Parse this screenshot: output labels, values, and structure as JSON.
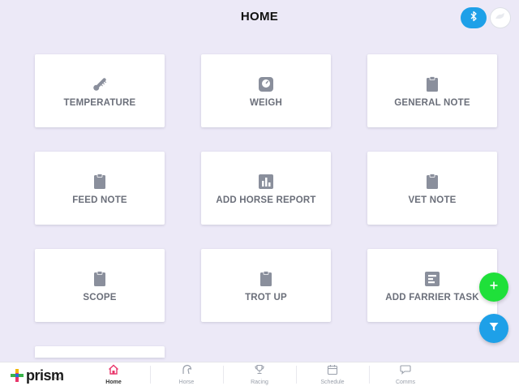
{
  "header": {
    "title": "HOME",
    "bluetooth_icon": "bluetooth-icon",
    "avatar_icon": "user-avatar"
  },
  "tiles": [
    {
      "label": "TEMPERATURE",
      "icon": "thermometer-icon"
    },
    {
      "label": "WEIGH",
      "icon": "scale-icon"
    },
    {
      "label": "GENERAL NOTE",
      "icon": "clipboard-icon"
    },
    {
      "label": "FEED NOTE",
      "icon": "clipboard-icon"
    },
    {
      "label": "ADD HORSE REPORT",
      "icon": "bar-chart-icon"
    },
    {
      "label": "VET NOTE",
      "icon": "clipboard-icon"
    },
    {
      "label": "SCOPE",
      "icon": "clipboard-icon"
    },
    {
      "label": "TROT UP",
      "icon": "clipboard-icon"
    },
    {
      "label": "ADD FARRIER TASK",
      "icon": "task-list-icon"
    }
  ],
  "fabs": {
    "add_icon": "plus-icon",
    "filter_icon": "filter-icon"
  },
  "logo": {
    "text": "prism",
    "sub": "PLUS"
  },
  "nav": [
    {
      "label": "Home",
      "icon": "home-icon",
      "active": true
    },
    {
      "label": "Horse",
      "icon": "horse-icon",
      "active": false
    },
    {
      "label": "Racing",
      "icon": "trophy-icon",
      "active": false
    },
    {
      "label": "Schedule",
      "icon": "calendar-icon",
      "active": false
    },
    {
      "label": "Comms",
      "icon": "chat-icon",
      "active": false
    }
  ],
  "colors": {
    "background": "#ece9f7",
    "accent_blue": "#1ea0e8",
    "accent_green": "#1fe03a",
    "icon_grey": "#8a8f9c",
    "home_active": "#e8366b"
  }
}
